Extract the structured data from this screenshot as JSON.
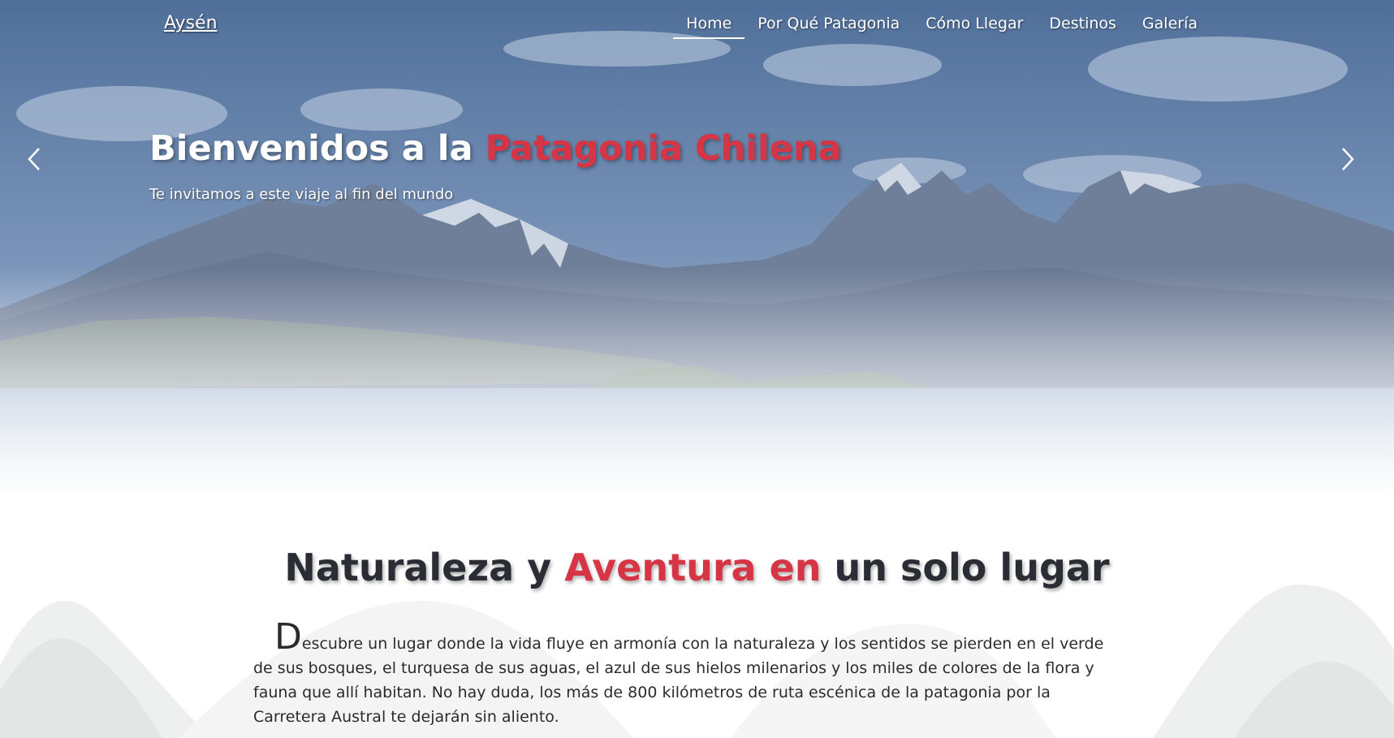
{
  "brand": "Aysén",
  "nav": [
    {
      "label": "Home",
      "active": true
    },
    {
      "label": "Por Qué Patagonia",
      "active": false
    },
    {
      "label": "Cómo Llegar",
      "active": false
    },
    {
      "label": "Destinos",
      "active": false
    },
    {
      "label": "Galería",
      "active": false
    }
  ],
  "hero": {
    "title_start": "Bienvenidos a la ",
    "title_accent": "Patagonia Chilena",
    "subtitle": "Te invitamos a este viaje al fin del mundo",
    "prev_icon": "chevron-left-icon",
    "next_icon": "chevron-right-icon"
  },
  "section": {
    "title_start": "Naturaleza y ",
    "title_accent": "Aventura en",
    "title_end": " un solo lugar",
    "dropcap": "D",
    "body": "escubre un lugar donde la vida fluye en armonía con la naturaleza y los sentidos se pierden en el verde de sus bosques, el turquesa de sus aguas, el azul de sus hielos milenarios y los miles de colores de la flora y fauna que allí habitan. No hay duda, los más de 800 kilómetros de ruta escénica de la patagonia por la Carretera Austral te dejarán sin aliento."
  },
  "colors": {
    "accent": "#d63545",
    "heading": "#2a2d33",
    "text": "#2b2b2b"
  }
}
